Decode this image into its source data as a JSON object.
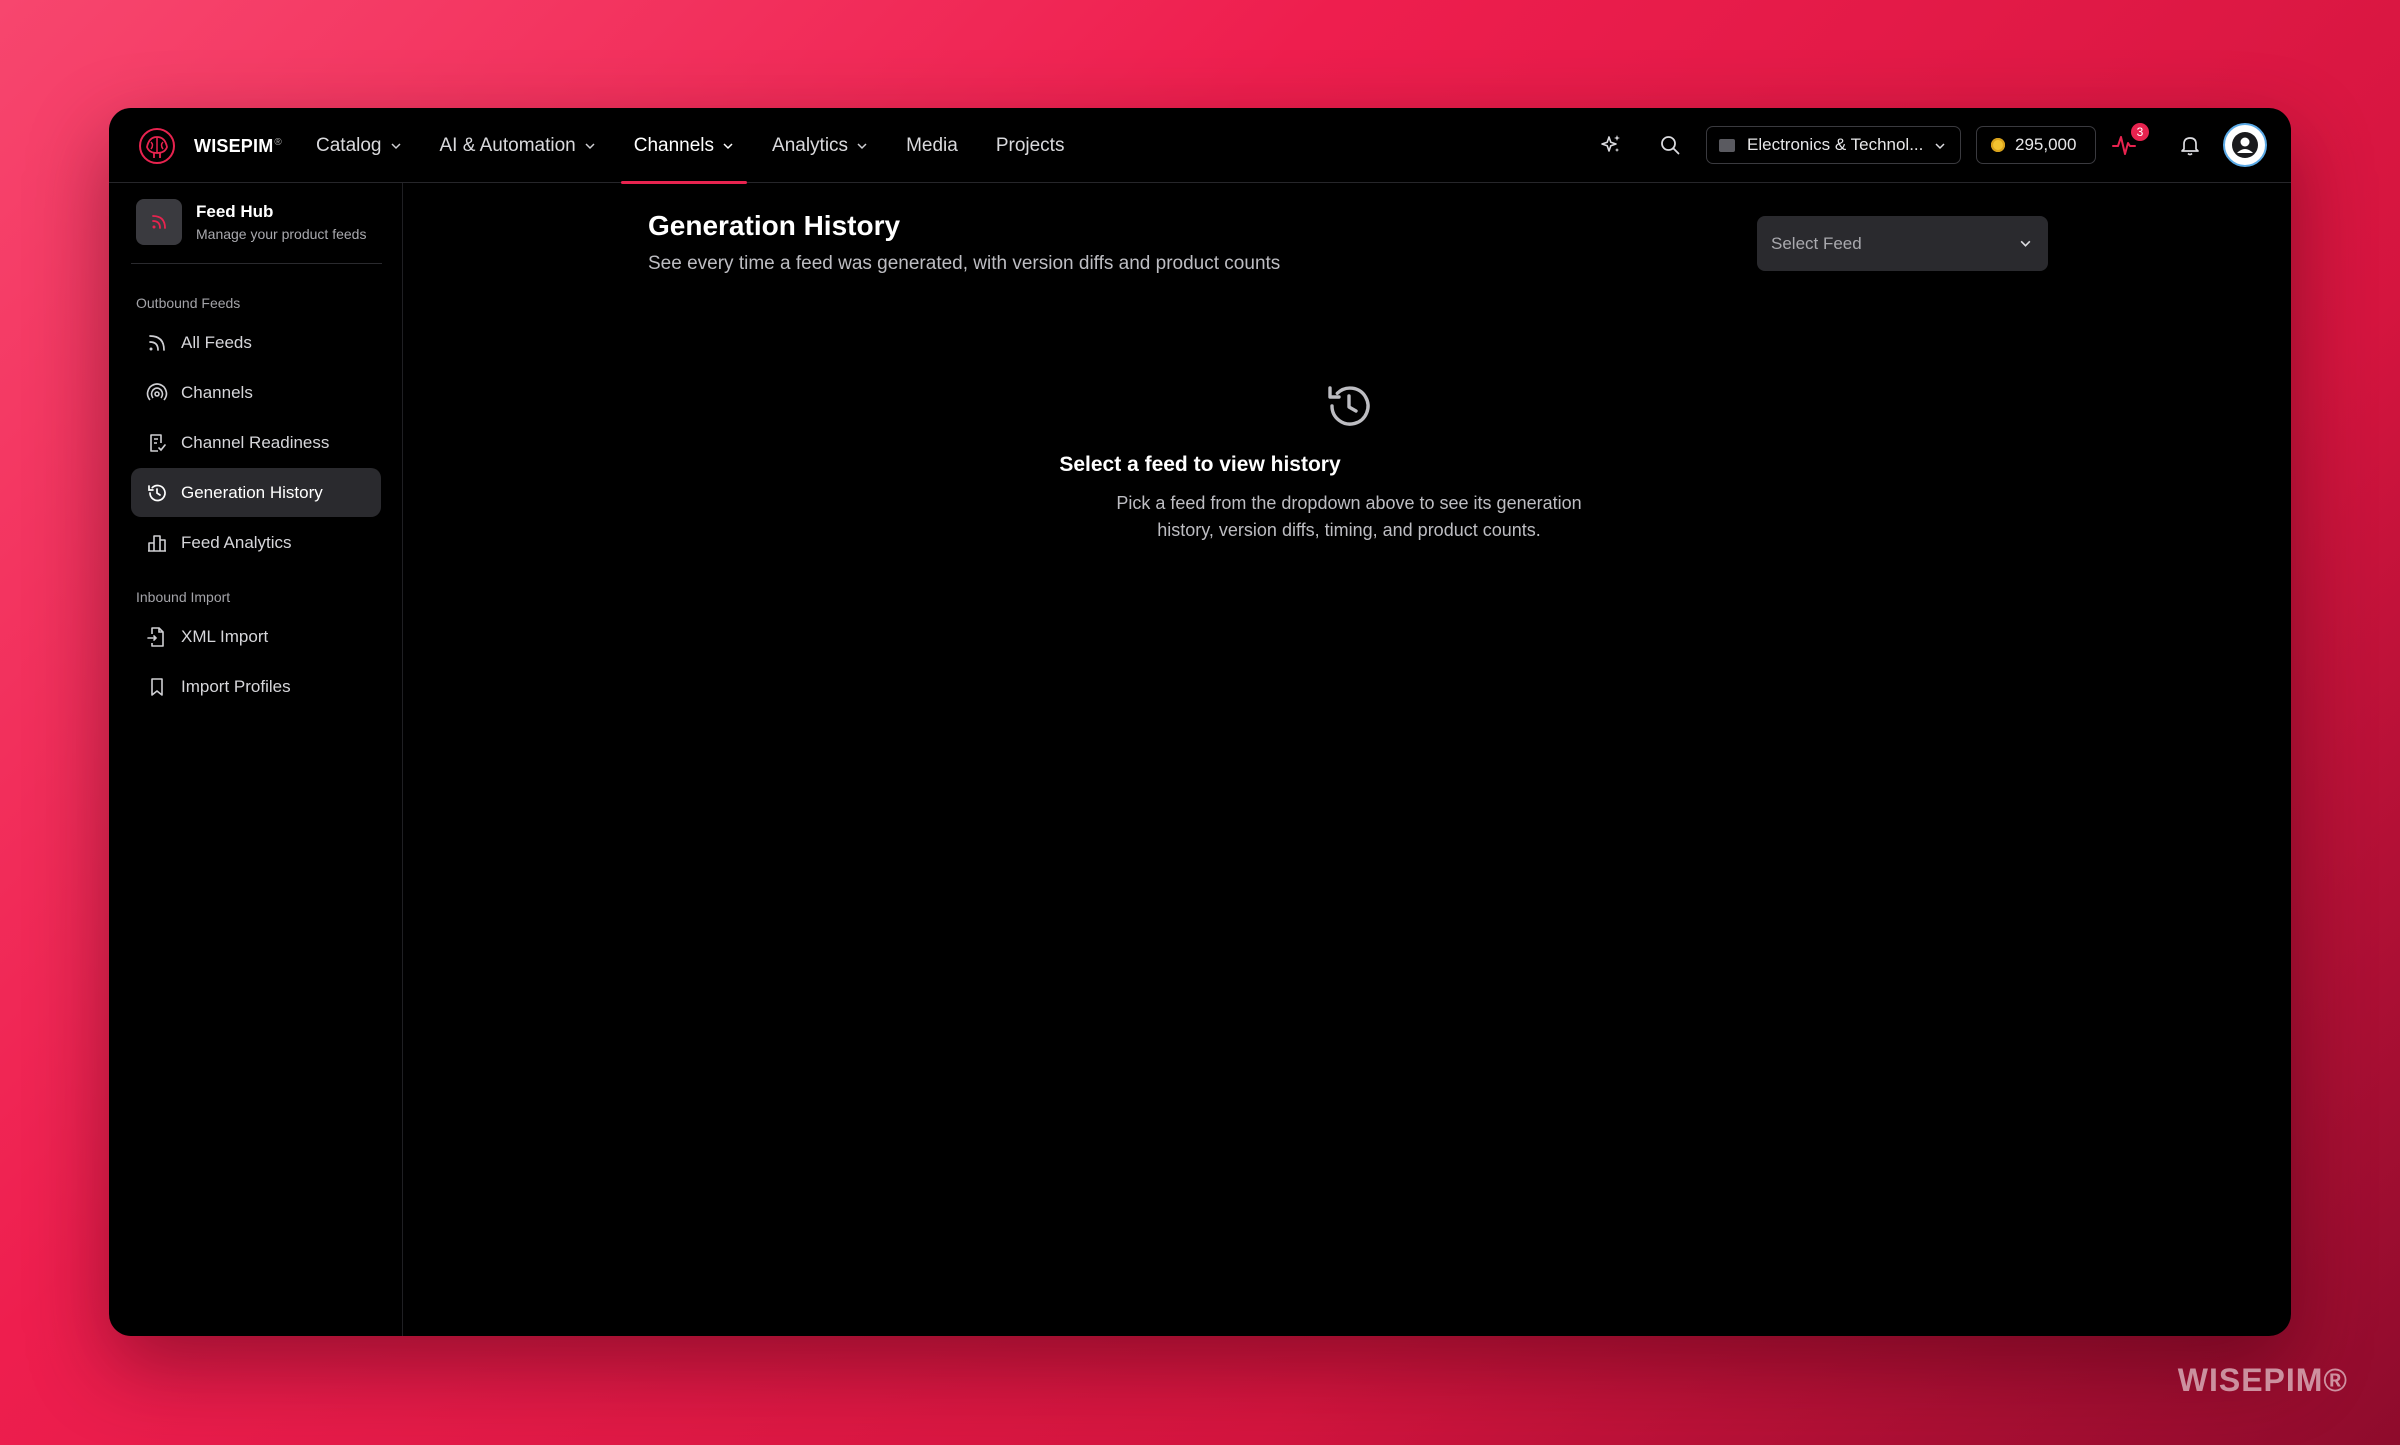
{
  "brand": {
    "name": "WISEPIM",
    "mark": "®"
  },
  "nav": {
    "items": [
      {
        "label": "Catalog",
        "has_menu": true,
        "active": false
      },
      {
        "label": "AI & Automation",
        "has_menu": true,
        "active": false
      },
      {
        "label": "Channels",
        "has_menu": true,
        "active": true
      },
      {
        "label": "Analytics",
        "has_menu": true,
        "active": false
      },
      {
        "label": "Media",
        "has_menu": false,
        "active": false
      },
      {
        "label": "Projects",
        "has_menu": false,
        "active": false
      }
    ]
  },
  "toolbar": {
    "workspace": "Electronics & Technol...",
    "credits": "295,000",
    "activity_badge": "3",
    "icons": [
      "sparkles-icon",
      "search-icon",
      "activity-icon",
      "bell-icon",
      "user-icon"
    ]
  },
  "sidebar": {
    "hub_title": "Feed Hub",
    "hub_subtitle": "Manage your product feeds",
    "sections": [
      {
        "label": "Outbound Feeds",
        "items": [
          {
            "label": "All Feeds",
            "icon": "rss-icon",
            "active": false
          },
          {
            "label": "Channels",
            "icon": "broadcast-icon",
            "active": false
          },
          {
            "label": "Channel Readiness",
            "icon": "clipboard-check-icon",
            "active": false
          },
          {
            "label": "Generation History",
            "icon": "history-icon",
            "active": true
          },
          {
            "label": "Feed Analytics",
            "icon": "bar-chart-icon",
            "active": false
          }
        ]
      },
      {
        "label": "Inbound Import",
        "items": [
          {
            "label": "XML Import",
            "icon": "file-import-icon",
            "active": false
          },
          {
            "label": "Import Profiles",
            "icon": "bookmark-icon",
            "active": false
          }
        ]
      }
    ]
  },
  "main": {
    "title": "Generation History",
    "subtitle": "See every time a feed was generated, with version diffs and product counts",
    "feed_select_placeholder": "Select Feed",
    "empty_title": "Select a feed to view history",
    "empty_description": "Pick a feed from the dropdown above to see its generation history, version diffs, timing, and product counts."
  },
  "watermark": "WISEPIM®",
  "colors": {
    "accent": "#e8234f",
    "background": "#000000",
    "page_bg": "#ee1e4e"
  }
}
